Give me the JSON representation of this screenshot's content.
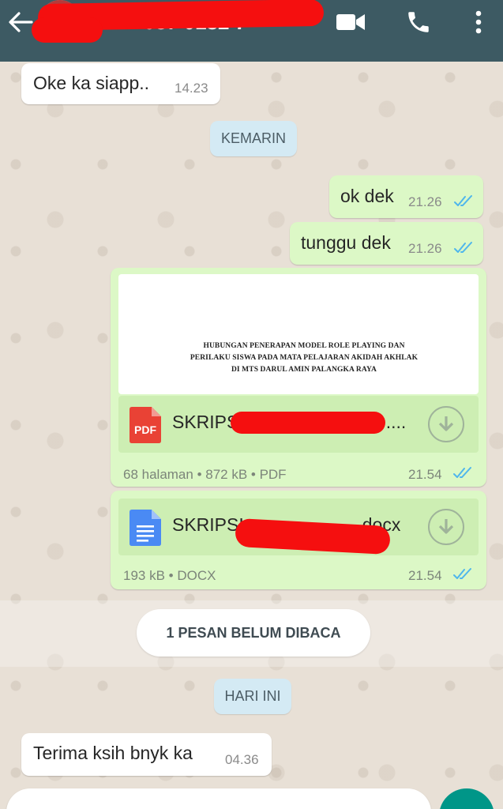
{
  "header": {
    "back_icon": "arrow-left-icon",
    "contact_name_visible": "087 0182 7",
    "video_icon": "video-call-icon",
    "call_icon": "phone-icon",
    "menu_icon": "more-vert-icon",
    "bg_color": "#3d5a63"
  },
  "messages": {
    "m1": {
      "text": "Oke ka siapp..",
      "time": "14.23"
    },
    "date_yesterday": "KEMARIN",
    "m2": {
      "text": "ok dek",
      "time": "21.26"
    },
    "m3": {
      "text": "tunggu dek",
      "time": "21.26"
    },
    "doc1": {
      "preview_title": "HUBUNGAN PENERAPAN MODEL ROLE PLAYING DAN PERILAKU SISWA PADA MATA PELAJARAN AKIDAH AKHLAK  DI MTS DARUL AMIN PALANGKA RAYA",
      "name_prefix": "SKRIPSI",
      "name_suffix": "....",
      "meta": "68 halaman • 872 kB • PDF",
      "time": "21.54",
      "icon": "pdf-file-icon",
      "icon_label": "PDF"
    },
    "doc2": {
      "name_prefix": "SKRIPSI",
      "name_suffix": "docx",
      "meta": "193 kB • DOCX",
      "time": "21.54",
      "icon": "docs-file-icon"
    },
    "unread_banner": "1 PESAN BELUM DIBACA",
    "date_today": "HARI INI",
    "m4": {
      "text": "Terima ksih bnyk ka",
      "time": "04.36"
    }
  },
  "colors": {
    "outgoing_bubble": "#dcf8c6",
    "incoming_bubble": "#ffffff",
    "read_ticks": "#4fb6ec",
    "redaction": "#f50f0f"
  }
}
